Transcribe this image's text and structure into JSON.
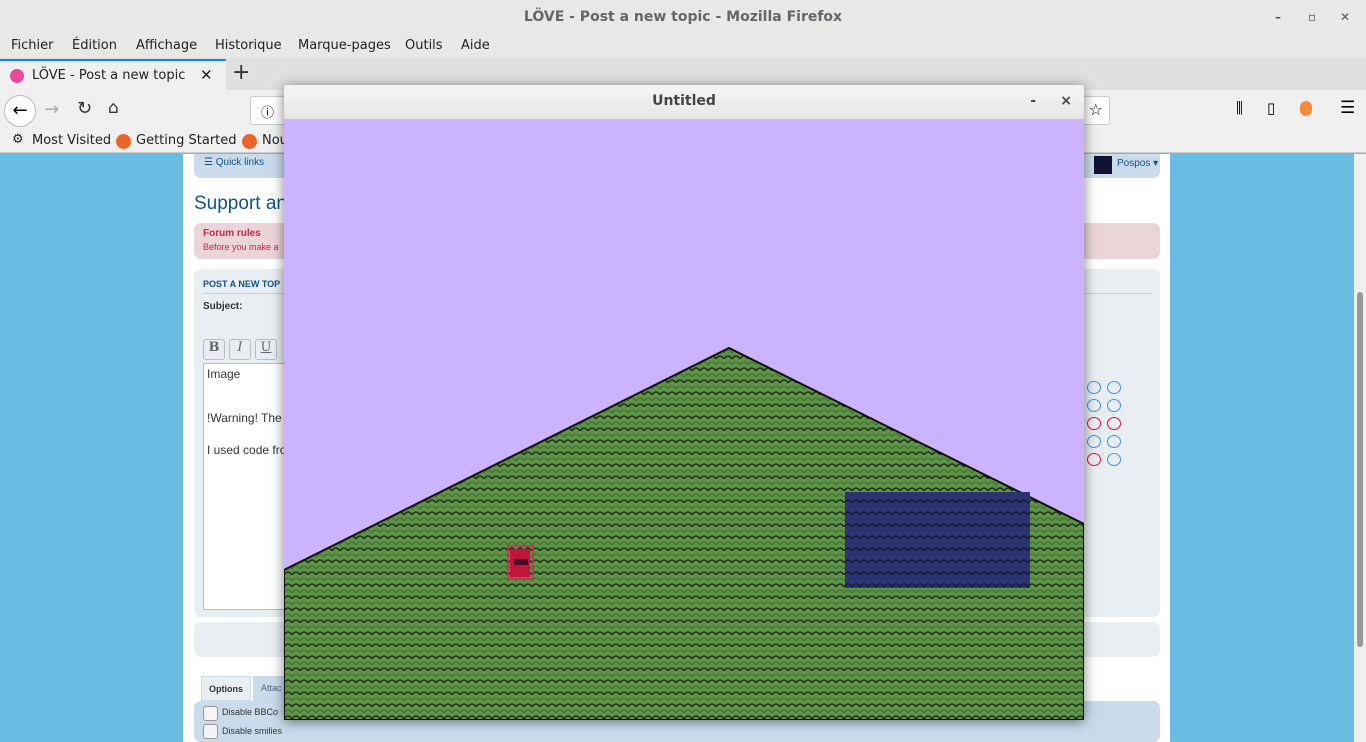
{
  "browser": {
    "window_title": "LÖVE - Post a new topic - Mozilla Firefox",
    "menu": [
      "Fichier",
      "Édition",
      "Affichage",
      "Historique",
      "Marque-pages",
      "Outils",
      "Aide"
    ],
    "tab_title": "LÖVE - Post a new topic",
    "bookmarks": [
      "Most Visited",
      "Getting Started",
      "Nou"
    ]
  },
  "forum": {
    "quick_links": "Quick links",
    "user": "Pospos",
    "heading": "Support an",
    "rules_title": "Forum rules",
    "rules_text": "Before you make a",
    "post_header": "POST A NEW TOP",
    "subject_label": "Subject:",
    "format_buttons": [
      "B",
      "I",
      "U"
    ],
    "body_lines": [
      "Image",
      "!Warning! The",
      "I used code fro"
    ],
    "tabs": [
      "Options",
      "Attac"
    ],
    "options": [
      "Disable BBCo",
      "Disable smilies"
    ]
  },
  "game": {
    "window_title": "Untitled",
    "minimize": "-",
    "close": "×",
    "sky_color": "#cbb3ff",
    "grass_color": "#5e9448",
    "water_color": "#2b3470"
  }
}
